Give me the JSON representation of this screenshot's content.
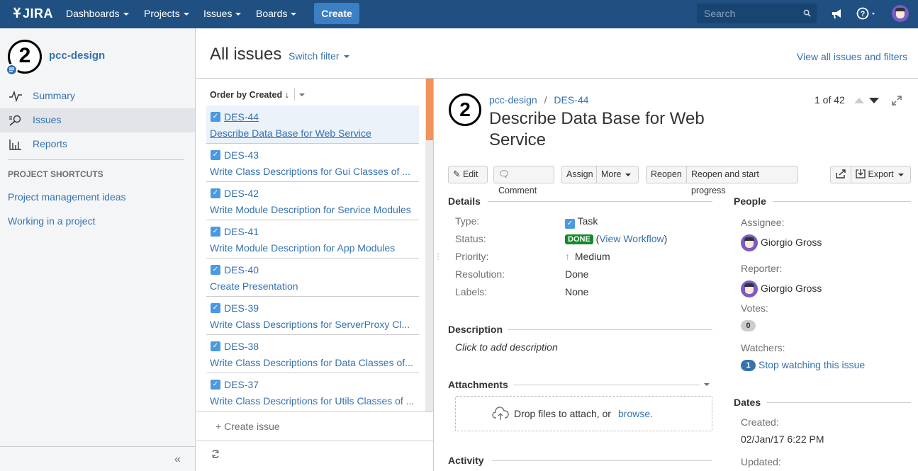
{
  "nav": {
    "logo": "JIRA",
    "items": [
      "Dashboards",
      "Projects",
      "Issues",
      "Boards"
    ],
    "create": "Create",
    "search_placeholder": "Search"
  },
  "sidebar": {
    "project_name": "pcc-design",
    "items": [
      {
        "label": "Summary",
        "icon": "activity-icon"
      },
      {
        "label": "Issues",
        "icon": "issues-search-icon"
      },
      {
        "label": "Reports",
        "icon": "reports-chart-icon"
      }
    ],
    "shortcuts_heading": "PROJECT SHORTCUTS",
    "shortcuts": [
      "Project management ideas",
      "Working in a project"
    ],
    "collapse": "«"
  },
  "header": {
    "title": "All issues",
    "switch_filter": "Switch filter",
    "view_all": "View all issues and filters"
  },
  "list": {
    "order_by": "Order by Created",
    "issues": [
      {
        "key": "DES-44",
        "summary": "Describe Data Base for Web Service"
      },
      {
        "key": "DES-43",
        "summary": "Write Class Descriptions for Gui Classes of ..."
      },
      {
        "key": "DES-42",
        "summary": "Write Module Description for Service Modules"
      },
      {
        "key": "DES-41",
        "summary": "Write Module Description for App Modules"
      },
      {
        "key": "DES-40",
        "summary": "Create Presentation"
      },
      {
        "key": "DES-39",
        "summary": "Write Class Descriptions for ServerProxy Cl..."
      },
      {
        "key": "DES-38",
        "summary": "Write Class Descriptions for Data Classes of..."
      },
      {
        "key": "DES-37",
        "summary": "Write Class Descriptions for Utils Classes of ..."
      }
    ],
    "create_issue": "+ Create issue"
  },
  "issue": {
    "breadcrumb_project": "pcc-design",
    "breadcrumb_sep": "/",
    "breadcrumb_key": "DES-44",
    "title": "Describe Data Base for Web Service",
    "pager": "1 of 42",
    "buttons": {
      "edit": "Edit",
      "comment": "Comment",
      "assign": "Assign",
      "more": "More",
      "reopen": "Reopen",
      "reopen_progress": "Reopen and start progress",
      "export": "Export"
    },
    "details_heading": "Details",
    "details": {
      "type_label": "Type:",
      "type_value": "Task",
      "status_label": "Status:",
      "status_value": "DONE",
      "view_workflow": "View Workflow",
      "priority_label": "Priority:",
      "priority_value": "Medium",
      "resolution_label": "Resolution:",
      "resolution_value": "Done",
      "labels_label": "Labels:",
      "labels_value": "None"
    },
    "description_heading": "Description",
    "description_placeholder": "Click to add description",
    "attachments_heading": "Attachments",
    "drop_text": "Drop files to attach, or",
    "browse": "browse.",
    "activity_heading": "Activity",
    "people_heading": "People",
    "assignee_label": "Assignee:",
    "assignee": "Giorgio Gross",
    "reporter_label": "Reporter:",
    "reporter": "Giorgio Gross",
    "votes_label": "Votes:",
    "votes": "0",
    "watchers_label": "Watchers:",
    "watchers_count": "1",
    "stop_watching": "Stop watching this issue",
    "dates_heading": "Dates",
    "created_label": "Created:",
    "created": "02/Jan/17 6:22 PM",
    "updated_label": "Updated:"
  },
  "colors": {
    "nav_bg": "#205081",
    "link": "#3572b0",
    "done_green": "#14892c",
    "priority_orange": "#f79232"
  }
}
